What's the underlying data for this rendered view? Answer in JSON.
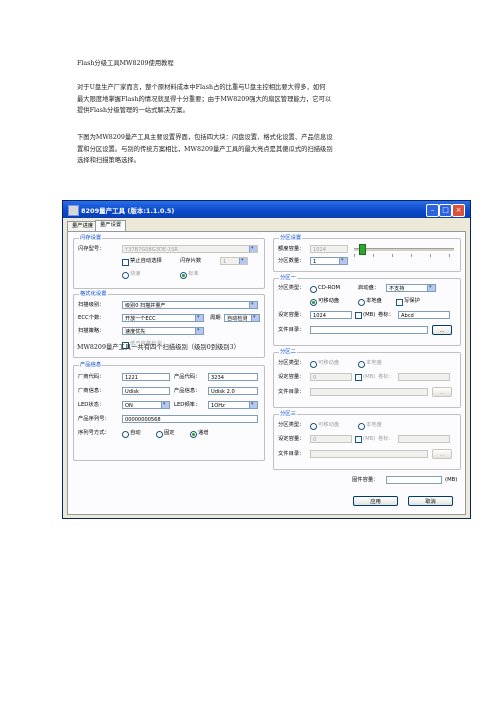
{
  "doc": {
    "title": "Flash分级工具MW8209使用教程",
    "para1_line1": "对于U盘生产厂家而言，整个原材料成本中Flash占的比重与U盘主控相比要大得多，如何",
    "para1_line2": "最大限度地掌握Flash的情况就显得十分重要；由于MW8209强大的扇区管理能力，它可以",
    "para1_line3": "提供Flash分级管理的一站式解决方案。",
    "para2_line1": "下图为MW8209量产工具主要设置界面，包括四大块：闪盘设置、格式化设置、产品信息设",
    "para2_line2": "置和分区设置。与别的传统方案相比，MW8209量产工具的最大亮点是其傻瓜式的扫描级别",
    "para2_line3": "选择和扫描策略选择。",
    "caption": "MW8209量产工具一共有四个扫描级别（级别0到级别3）"
  },
  "app": {
    "title": "8209量产工具 (版本:1.1.0.5)",
    "tabs": [
      "量产进度",
      "量产设置"
    ],
    "flash_group": {
      "title": "闪存设置",
      "type_label": "闪存型号：",
      "type_value": "Y37B7G08G3DE-1SR",
      "disable_autoselect": "禁止自动选择",
      "chip_count_label": "闪存片数",
      "chip_count_value": "1",
      "opt_fast": "快速",
      "opt_normal": "标准"
    },
    "format_group": {
      "title": "格式化设置",
      "scan_level_label": "扫描级别：",
      "scan_level_value": "级别0 扫描并量产",
      "ecc_label": "ECC个数：",
      "ecc_value": "开放一个ECC",
      "cycle_label": "周期",
      "cycle_value": "自动检测",
      "strategy_label": "扫描策略：",
      "strategy_value": "速度优先",
      "small_capacity": "低产容量检测"
    },
    "product_group": {
      "title": "产品信息",
      "vid_label": "厂商代码：",
      "vid_value": "1221",
      "pid_label": "产品代码：",
      "pid_value": "3234",
      "vendor_label": "厂商信息：",
      "vendor_value": "Udisk",
      "product_label": "产品信息：",
      "product_value": "Udisk 2.0",
      "led_label": "LED状态：",
      "led_value": "ON",
      "led_freq_label": "LED频率：",
      "led_freq_value": "1OHz",
      "serial_label": "产品序列号：",
      "serial_value": "00000000568",
      "serial_mode_label": "序列号方式：",
      "serial_auto": "自动",
      "serial_fixed": "固定",
      "serial_inc": "递增"
    },
    "partition_group": {
      "title": "分区设置",
      "total_label": "额度容量：",
      "total_value": "1024",
      "count_label": "分区数量：",
      "count_value": "1"
    },
    "partition1": {
      "title": "分区一",
      "type_label": "分区类型：",
      "cdrom": "CD-ROM",
      "boot_label": "启动盘：",
      "boot_value": "不支持",
      "removable": "可移动盘",
      "local": "本地盘",
      "write_protect": "写保护",
      "cap_label": "设定容量：",
      "cap_value": "1024",
      "unit": "(MB)",
      "vol_label": "卷标：",
      "vol_value": "Abcd",
      "file_label": "文件目录：",
      "browse": "..."
    },
    "partition2": {
      "title": "分区二",
      "type_label": "分区类型：",
      "removable": "可移动盘",
      "local": "本地盘",
      "cap_label": "设定容量：",
      "cap_value": "0",
      "unit": "(MB)",
      "vol_label": "卷标：",
      "file_label": "文件目录：",
      "browse": "..."
    },
    "partition3": {
      "title": "分区三",
      "type_label": "分区类型：",
      "removable": "可移动盘",
      "local": "本地盘",
      "cap_label": "设定容量：",
      "cap_value": "0",
      "unit": "(MB)",
      "vol_label": "卷标：",
      "file_label": "文件目录：",
      "browse": "..."
    },
    "firmware_label": "固件容量：",
    "firmware_unit": "(MB)",
    "apply_label": "应用",
    "cancel_label": "取消",
    "slider_level": 0.05
  }
}
